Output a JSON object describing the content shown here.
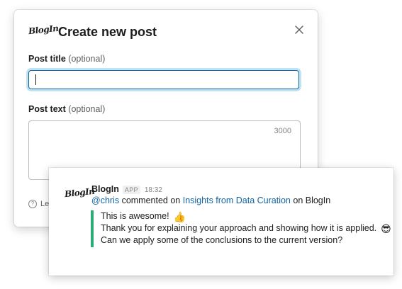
{
  "modal": {
    "logo_text": "BlogIn",
    "title": "Create new post",
    "close_icon": "close-icon",
    "post_title_label": "Post title",
    "post_title_optional": "(optional)",
    "post_title_value": "",
    "post_text_label": "Post text",
    "post_text_optional": "(optional)",
    "post_text_value": "",
    "char_count": "3000",
    "footer_hint_visible": "Lea",
    "footer_icon": "help-icon"
  },
  "message": {
    "logo_text": "BlogIn",
    "sender": "BlogIn",
    "badge": "APP",
    "time": "18:32",
    "mention": "@chris",
    "action_text": " commented on ",
    "post_link": "Insights from Data Curation",
    "suffix_text": " on BlogIn",
    "quote_lines": [
      {
        "text": "This is awesome!",
        "emoji": "👍"
      },
      {
        "text": "Thank you for explaining your approach and showing how it is applied.",
        "emoji": "😎"
      },
      {
        "text": "Can we apply some of the conclusions to the current version?",
        "emoji": ""
      }
    ],
    "quote_bar_color": "#2bac76",
    "link_color": "#1264a3"
  }
}
